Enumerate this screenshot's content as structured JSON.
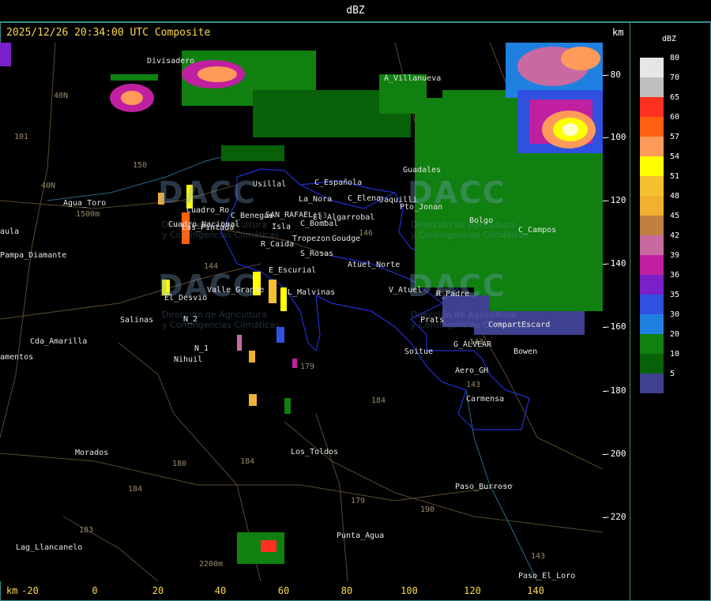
{
  "header": {
    "title": "dBZ"
  },
  "timestamp": "2025/12/26 20:34:00 UTC Composite",
  "axis": {
    "unit_label": "km",
    "x_ticks": [
      "-20",
      "0",
      "20",
      "40",
      "60",
      "80",
      "100",
      "120",
      "140"
    ],
    "y_ticks": [
      "-80",
      "-100",
      "-120",
      "-140",
      "-160",
      "-180",
      "-200",
      "-220"
    ]
  },
  "legend": {
    "title": "dBZ",
    "items": [
      {
        "label": "80",
        "color": "#e6e6e6"
      },
      {
        "label": "70",
        "color": "#bfbfbf"
      },
      {
        "label": "65",
        "color": "#ff3020"
      },
      {
        "label": "60",
        "color": "#ff6010"
      },
      {
        "label": "57",
        "color": "#ff9a5a"
      },
      {
        "label": "54",
        "color": "#ffff00"
      },
      {
        "label": "51",
        "color": "#f5c030"
      },
      {
        "label": "48",
        "color": "#f0b030"
      },
      {
        "label": "45",
        "color": "#c08040"
      },
      {
        "label": "42",
        "color": "#c86aa0"
      },
      {
        "label": "39",
        "color": "#c020a0"
      },
      {
        "label": "36",
        "color": "#7a20c8"
      },
      {
        "label": "35",
        "color": "#3050e0"
      },
      {
        "label": "30",
        "color": "#2080e0"
      },
      {
        "label": "20",
        "color": "#108010"
      },
      {
        "label": "10",
        "color": "#086008"
      },
      {
        "label": "5",
        "color": "#404090"
      }
    ]
  },
  "watermark": {
    "brand": "DACC",
    "line1": "Dirección de Agricultura",
    "line2": "y Contingencias Climáticas"
  },
  "places": [
    "Divisadero",
    "A_Villanueva",
    "Guadales",
    "Usillal",
    "La_Nora",
    "C_Española",
    "C_Elena",
    "Jaquilli",
    "Pto_Jonan",
    "Agua_Toro",
    "Cuadro_Ro",
    "C_Benegas",
    "SAN_RAFAEL",
    "El_Algarrobal",
    "Isla",
    "Cuadro_Nacional",
    "Las_Pintada",
    "C_Bombal",
    "Tropezon",
    "Goudge",
    "R_Caida",
    "S_Rosas",
    "Atuel_Norte",
    "E_Escurial",
    "Valle_Grande",
    "L_Malvinas",
    "V_Atuel",
    "R_Padre",
    "El_Desvio",
    "Salinas",
    "Prats",
    "CompartEscard",
    "N_2",
    "G_ALVEAR",
    "Bowen",
    "N_1",
    "Nihuil",
    "Soitue",
    "Aero_GH",
    "Carmensa",
    "Cda_Amarilla",
    "amentos",
    "Morados",
    "Los_Toldos",
    "Paso_Burroso",
    "Punta_Agua",
    "Lag_Llancanelo",
    "Paso_El_Loro",
    "Pampa_Diamante",
    "aula",
    "C_Campos",
    "Bolgo"
  ],
  "routes": [
    "40N",
    "40N",
    "101",
    "150",
    "144",
    "179",
    "184",
    "143",
    "180",
    "184",
    "184",
    "183",
    "179",
    "190",
    "143",
    "143",
    "153",
    "146"
  ],
  "elevations": [
    "1500m",
    "2200m"
  ]
}
